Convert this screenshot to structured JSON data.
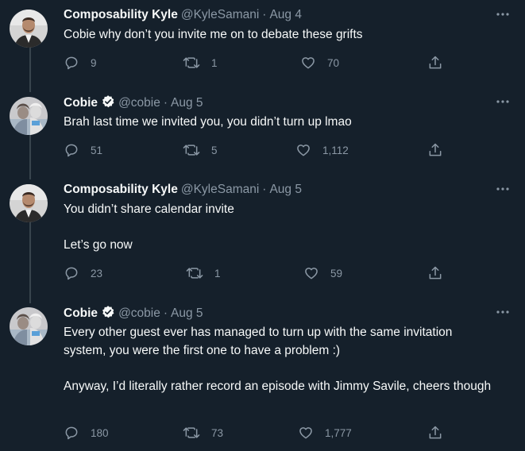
{
  "tweets": [
    {
      "name": "Composability Kyle",
      "handle": "@KyleSamani",
      "separator": "·",
      "date": "Aug 4",
      "verified": false,
      "paragraphs": [
        "Cobie why don’t you invite me on to debate these grifts"
      ],
      "replies": "9",
      "retweets": "1",
      "likes": "70"
    },
    {
      "name": "Cobie",
      "handle": "@cobie",
      "separator": "·",
      "date": "Aug 5",
      "verified": true,
      "paragraphs": [
        "Brah last time we invited you, you didn’t turn up lmao"
      ],
      "replies": "51",
      "retweets": "5",
      "likes": "1,112"
    },
    {
      "name": "Composability Kyle",
      "handle": "@KyleSamani",
      "separator": "·",
      "date": "Aug 5",
      "verified": false,
      "paragraphs": [
        "You didn’t share calendar invite",
        "Let’s go now"
      ],
      "replies": "23",
      "retweets": "1",
      "likes": "59"
    },
    {
      "name": "Cobie",
      "handle": "@cobie",
      "separator": "·",
      "date": "Aug 5",
      "verified": true,
      "paragraphs": [
        "Every other guest ever has managed to turn up with the same invitation system, you were the first one to have a problem :)",
        "Anyway, I’d literally rather record an episode with Jimmy Savile, cheers though"
      ],
      "replies": "180",
      "retweets": "73",
      "likes": "1,777"
    }
  ],
  "icons": {
    "reply": "reply-icon",
    "retweet": "retweet-icon",
    "like": "like-icon",
    "share": "share-icon",
    "more": "more-icon",
    "verified": "verified-badge-icon"
  },
  "colors": {
    "background": "#15202b",
    "text": "#f7f9f9",
    "secondary": "#8b98a5",
    "thread_line": "#38444d",
    "verified": "#f7f9f9"
  }
}
